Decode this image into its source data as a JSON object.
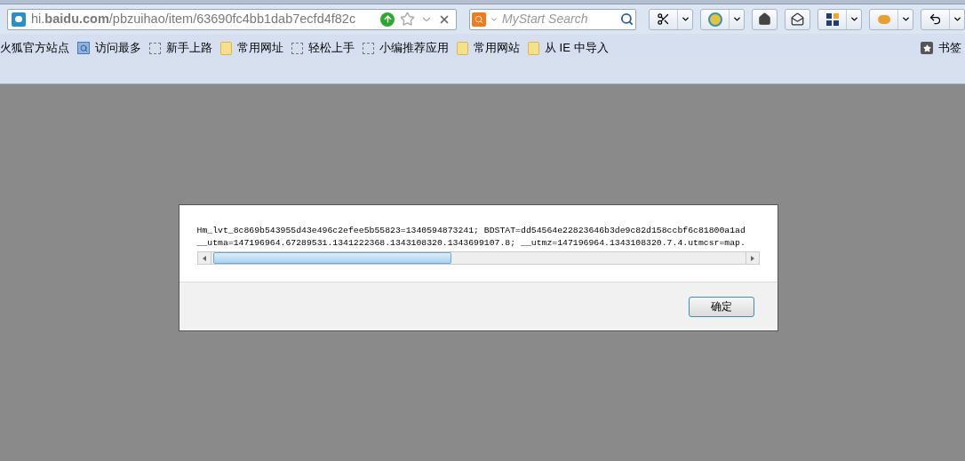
{
  "address_bar": {
    "url": "hi.**baidu.com**/pbzuihao/item/63690fc4bb1dab7ecfd4f82c"
  },
  "search": {
    "placeholder": "MyStart Search"
  },
  "bookmarks": [
    {
      "kind": "none",
      "label": "火狐官方站点"
    },
    {
      "kind": "page",
      "label": "访问最多"
    },
    {
      "kind": "dashed",
      "label": "新手上路"
    },
    {
      "kind": "folder",
      "label": "常用网址"
    },
    {
      "kind": "dashed",
      "label": "轻松上手"
    },
    {
      "kind": "dashed",
      "label": "小编推荐应用"
    },
    {
      "kind": "folder",
      "label": "常用网站"
    },
    {
      "kind": "folder",
      "label": "从 IE 中导入"
    }
  ],
  "bookmarks_menu": {
    "label": "书签"
  },
  "dialog": {
    "lines": [
      "Hm_lvt_8c869b543955d43e496c2efee5b55823=1340594873241; BDSTAT=dd54564e22823646b3de9c82d158ccbf6c81800a1ad",
      "__utma=147196964.67289531.1341222368.1343108320.1343699107.8; __utmz=147196964.1343108320.7.4.utmcsr=map."
    ],
    "button": "确定"
  }
}
